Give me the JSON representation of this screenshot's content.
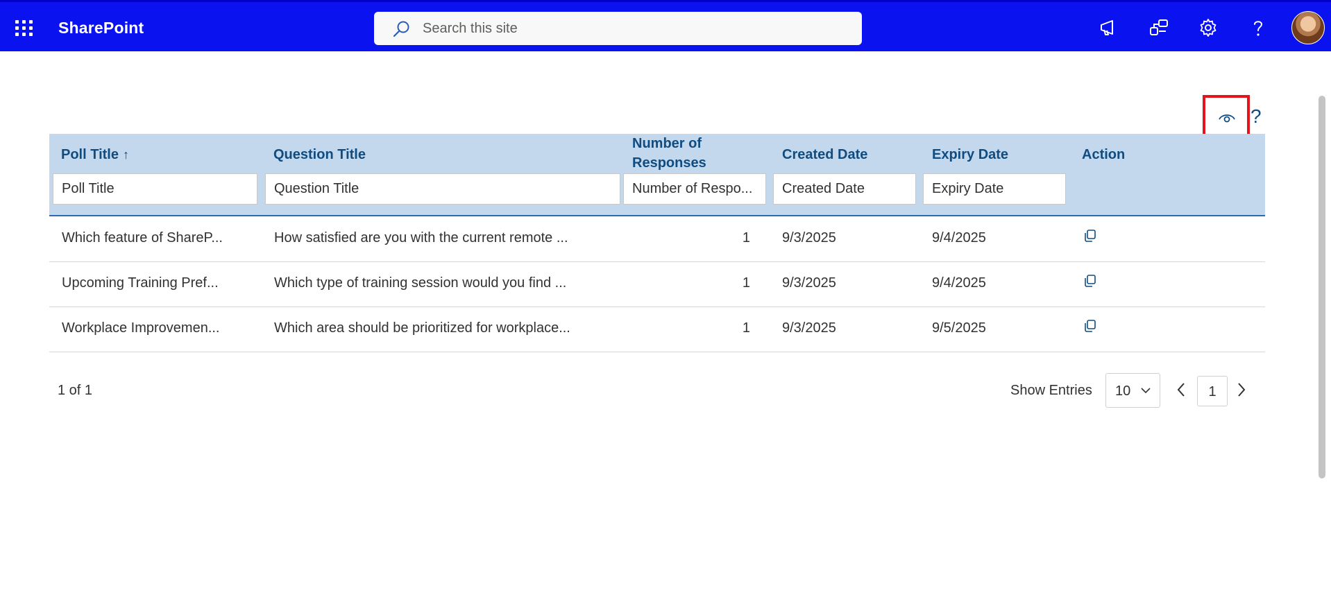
{
  "app": {
    "brand": "SharePoint"
  },
  "search": {
    "placeholder": "Search this site"
  },
  "icons": {
    "waffle": "waffle-icon",
    "megaphone": "megaphone-icon",
    "connections": "connections-icon",
    "settings": "gear-icon",
    "help": "help-icon",
    "view": "eye-icon",
    "copy": "copy-icon"
  },
  "colors": {
    "suitebar": "#0b12f0",
    "header_bg": "#c3d8ec",
    "header_text": "#0f4c81",
    "highlight": "#e3141b"
  },
  "toolbar": {
    "help_label": "?"
  },
  "table": {
    "columns": [
      {
        "label": "Poll Title",
        "sort": "↑",
        "filter_placeholder": "Poll Title"
      },
      {
        "label": "Question Title",
        "filter_placeholder": "Question Title"
      },
      {
        "label": "Number of Responses",
        "filter_placeholder": "Number of Respo..."
      },
      {
        "label": "Created Date",
        "filter_placeholder": "Created Date"
      },
      {
        "label": "Expiry Date",
        "filter_placeholder": "Expiry Date"
      },
      {
        "label": "Action"
      }
    ],
    "rows": [
      {
        "poll": "Which feature of ShareP...",
        "question": "How satisfied are you with the current remote ...",
        "responses": "1",
        "created": "9/3/2025",
        "expiry": "9/4/2025"
      },
      {
        "poll": "Upcoming Training Pref...",
        "question": "Which type of training session would you find ...",
        "responses": "1",
        "created": "9/3/2025",
        "expiry": "9/4/2025"
      },
      {
        "poll": "Workplace Improvemen...",
        "question": "Which area should be prioritized for workplace...",
        "responses": "1",
        "created": "9/3/2025",
        "expiry": "9/5/2025"
      }
    ]
  },
  "pager": {
    "info": "1 of 1",
    "show_entries_label": "Show Entries",
    "entries_value": "10",
    "current_page": "1"
  }
}
